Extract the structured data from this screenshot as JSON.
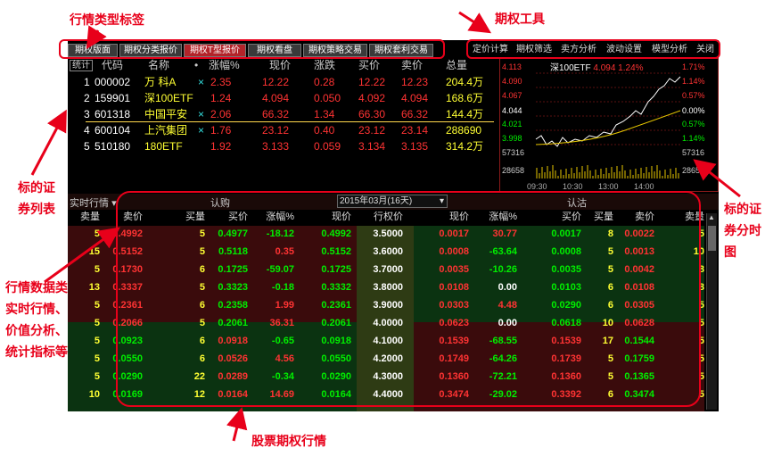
{
  "annotations": {
    "quote_type_tabs": "行情类型标签",
    "option_tools": "期权工具",
    "security_list": [
      "标的证",
      "券列表"
    ],
    "timeshare": [
      "标的证",
      "券分时",
      "图"
    ],
    "data_types": [
      "行情数据类型：",
      "实时行情、",
      "价值分析、",
      "统计指标等"
    ],
    "stock_options": "股票期权行情"
  },
  "tabs": [
    "期权版面",
    "期权分类报价",
    "期权T型报价",
    "期权看盘",
    "期权策略交易",
    "期权套利交易"
  ],
  "active_tab": 2,
  "tools": [
    "定价计算",
    "期权筛选",
    "卖方分析",
    "波动设置",
    "模型分析",
    "关闭"
  ],
  "stock_list": {
    "tag": "统计",
    "headers": [
      "代码",
      "名称",
      "•",
      "涨幅%",
      "现价",
      "涨跌",
      "买价",
      "卖价",
      "总量"
    ],
    "rows": [
      {
        "n": "1",
        "code": "000002",
        "name": "万 科A",
        "mark": "×",
        "pct": "2.35",
        "price": "12.22",
        "chg": "0.28",
        "bid": "12.22",
        "ask": "12.23",
        "vol": "204.4万"
      },
      {
        "n": "2",
        "code": "159901",
        "name": "深100ETF",
        "mark": "",
        "pct": "1.24",
        "price": "4.094",
        "chg": "0.050",
        "bid": "4.092",
        "ask": "4.094",
        "vol": "168.6万"
      },
      {
        "n": "3",
        "code": "601318",
        "name": "中国平安",
        "mark": "×",
        "pct": "2.06",
        "price": "66.32",
        "chg": "1.34",
        "bid": "66.30",
        "ask": "66.32",
        "vol": "144.4万"
      },
      {
        "n": "4",
        "code": "600104",
        "name": "上汽集团",
        "mark": "×",
        "pct": "1.76",
        "price": "23.12",
        "chg": "0.40",
        "bid": "23.12",
        "ask": "23.14",
        "vol": "288690"
      },
      {
        "n": "5",
        "code": "510180",
        "name": "180ETF",
        "mark": "",
        "pct": "1.92",
        "price": "3.133",
        "chg": "0.059",
        "bid": "3.134",
        "ask": "3.135",
        "vol": "314.2万"
      }
    ]
  },
  "chart": {
    "title": "深100ETF",
    "price": "4.094",
    "pct": "1.24%",
    "left_ticks": [
      "4.113",
      "4.090",
      "4.067",
      "4.044",
      "4.021",
      "3.998",
      "57316",
      "28658"
    ],
    "right_ticks": [
      "1.71%",
      "1.14%",
      "0.57%",
      "0.00%",
      "0.57%",
      "1.14%",
      "57316",
      "28658"
    ],
    "times": [
      "09:30",
      "10:30",
      "13:00",
      "14:00"
    ]
  },
  "options": {
    "mode": "实时行情",
    "call_label": "认购",
    "put_label": "认沽",
    "month": "2015年03月(16天)",
    "headers": [
      "卖量",
      "卖价",
      "买量",
      "买价",
      "涨幅%",
      "现价",
      "行权价",
      "现价",
      "涨幅%",
      "买价",
      "买量",
      "卖价",
      "卖量"
    ],
    "rows": [
      [
        "5",
        "0.4992",
        "5",
        "0.4977",
        "-18.12",
        "0.4992",
        "3.5000",
        "0.0017",
        "30.77",
        "0.0017",
        "8",
        "0.0022",
        "5"
      ],
      [
        "15",
        "0.5152",
        "5",
        "0.5118",
        "0.35",
        "0.5152",
        "3.6000",
        "0.0008",
        "-63.64",
        "0.0008",
        "5",
        "0.0013",
        "10"
      ],
      [
        "5",
        "0.1730",
        "6",
        "0.1725",
        "-59.07",
        "0.1725",
        "3.7000",
        "0.0035",
        "-10.26",
        "0.0035",
        "5",
        "0.0042",
        "8"
      ],
      [
        "13",
        "0.3337",
        "5",
        "0.3323",
        "-0.18",
        "0.3332",
        "3.8000",
        "0.0108",
        "0.00",
        "0.0103",
        "6",
        "0.0108",
        "8"
      ],
      [
        "5",
        "0.2361",
        "6",
        "0.2358",
        "1.99",
        "0.2361",
        "3.9000",
        "0.0303",
        "4.48",
        "0.0290",
        "6",
        "0.0305",
        "5"
      ],
      [
        "5",
        "0.2066",
        "5",
        "0.2061",
        "36.31",
        "0.2061",
        "4.0000",
        "0.0623",
        "0.00",
        "0.0618",
        "10",
        "0.0628",
        "5"
      ],
      [
        "5",
        "0.0923",
        "6",
        "0.0918",
        "-0.65",
        "0.0918",
        "4.1000",
        "0.1539",
        "-68.55",
        "0.1539",
        "17",
        "0.1544",
        "5"
      ],
      [
        "5",
        "0.0550",
        "6",
        "0.0526",
        "4.56",
        "0.0550",
        "4.2000",
        "0.1749",
        "-64.26",
        "0.1739",
        "5",
        "0.1759",
        "5"
      ],
      [
        "5",
        "0.0290",
        "22",
        "0.0289",
        "-0.34",
        "0.0290",
        "4.3000",
        "0.1360",
        "-72.21",
        "0.1360",
        "5",
        "0.1365",
        "5"
      ],
      [
        "10",
        "0.0169",
        "12",
        "0.0164",
        "14.69",
        "0.0164",
        "4.4000",
        "0.3474",
        "-29.02",
        "0.3392",
        "6",
        "0.3474",
        "5"
      ]
    ]
  }
}
